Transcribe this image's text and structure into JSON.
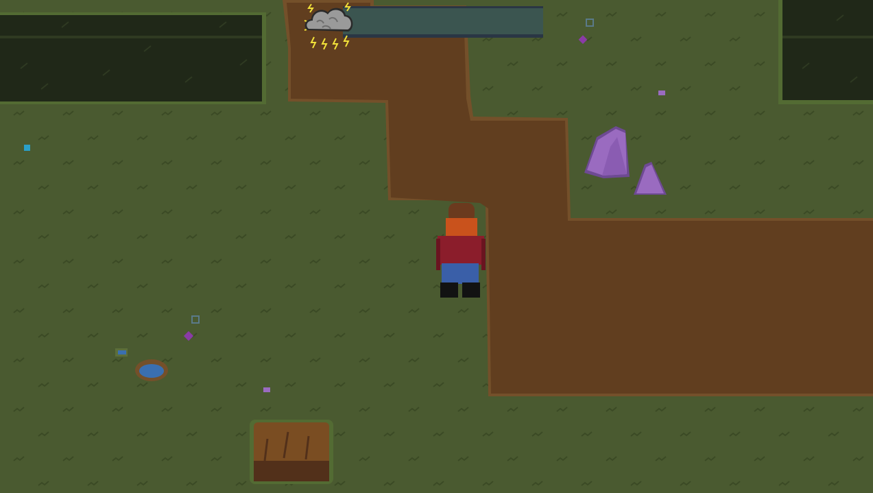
{
  "hud": {
    "weather_icon": "thunderstorm-cloud-icon",
    "weather_meter_level": 1.0
  },
  "palette": {
    "grass": "#4a5a30",
    "grass_detail": "#3d4b26",
    "grass_light": "#5c6e3a",
    "dirt": "#613e1f",
    "dirt_edge": "#74502a",
    "hedge": "#202818",
    "hedge_edge": "#536b33",
    "hedge_line": "#2f3a22",
    "rock": "#9a6bc0",
    "rock_shadow": "#6e4a93",
    "hay": "#7a4d22",
    "hay_dark": "#52301a",
    "water": "#3a6fb0",
    "meter_bg": "#3b5550",
    "meter_border": "#2a3644",
    "cloud": "#9a9a9a",
    "lightning": "#f2e23a"
  },
  "player": {
    "hair_color": "#6b3a1e",
    "beard_color": "#c9521c",
    "shirt_color": "#8b1d2b",
    "pants_color": "#3a5fa8",
    "boots_color": "#121212"
  }
}
